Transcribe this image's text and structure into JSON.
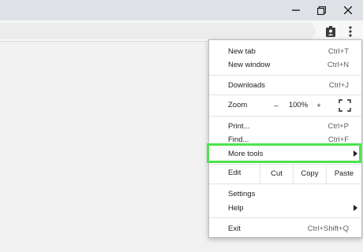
{
  "window_controls": {
    "minimize": "minimize-icon",
    "restore": "restore-icon",
    "close": "close-icon"
  },
  "toolbar": {
    "profile_icon": "profile-badge-icon",
    "menu_icon": "three-dot-menu-icon"
  },
  "menu": {
    "new_tab": {
      "label": "New tab",
      "shortcut": "Ctrl+T"
    },
    "new_window": {
      "label": "New window",
      "shortcut": "Ctrl+N"
    },
    "downloads": {
      "label": "Downloads",
      "shortcut": "Ctrl+J"
    },
    "zoom": {
      "label": "Zoom",
      "minus": "–",
      "value": "100%",
      "plus": "+"
    },
    "print": {
      "label": "Print...",
      "shortcut": "Ctrl+P"
    },
    "find": {
      "label": "Find...",
      "shortcut": "Ctrl+F"
    },
    "more_tools": {
      "label": "More tools"
    },
    "edit": {
      "label": "Edit",
      "cut": "Cut",
      "copy": "Copy",
      "paste": "Paste"
    },
    "settings": {
      "label": "Settings"
    },
    "help": {
      "label": "Help"
    },
    "exit": {
      "label": "Exit",
      "shortcut": "Ctrl+Shift+Q"
    }
  },
  "highlight_color": "#4ce34c"
}
